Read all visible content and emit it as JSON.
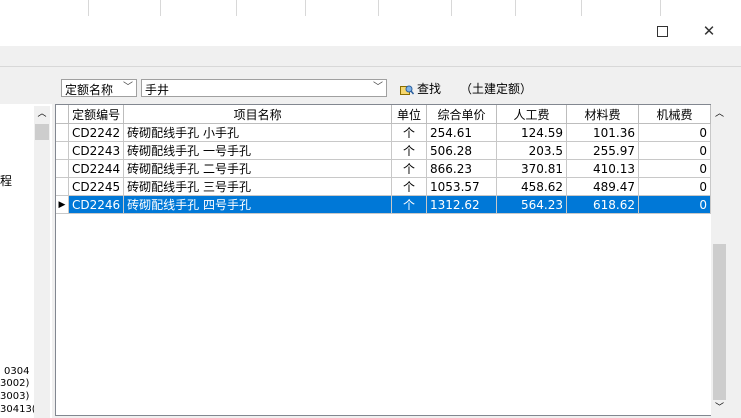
{
  "toolbar": {
    "field_select": "定额名称",
    "search_value": "手井",
    "find_label": "查找",
    "scope_label": "（土建定额）"
  },
  "left_panel": {
    "fragment_top": "程",
    "fragments_bottom": [
      "0304",
      "3002)",
      "3003)",
      "30413("
    ]
  },
  "grid": {
    "columns": [
      "定额编号",
      "项目名称",
      "单位",
      "综合单价",
      "人工费",
      "材料费",
      "机械费"
    ],
    "rows": [
      {
        "code": "CD2242",
        "name": "砖砌配线手孔 小手孔",
        "unit": "个",
        "price": "254.61",
        "labor": "124.59",
        "material": "101.36",
        "machine": "0"
      },
      {
        "code": "CD2243",
        "name": "砖砌配线手孔 一号手孔",
        "unit": "个",
        "price": "506.28",
        "labor": "203.5",
        "material": "255.97",
        "machine": "0"
      },
      {
        "code": "CD2244",
        "name": "砖砌配线手孔 二号手孔",
        "unit": "个",
        "price": "866.23",
        "labor": "370.81",
        "material": "410.13",
        "machine": "0"
      },
      {
        "code": "CD2245",
        "name": "砖砌配线手孔 三号手孔",
        "unit": "个",
        "price": "1053.57",
        "labor": "458.62",
        "material": "489.47",
        "machine": "0"
      },
      {
        "code": "CD2246",
        "name": "砖砌配线手孔 四号手孔",
        "unit": "个",
        "price": "1312.62",
        "labor": "564.23",
        "material": "618.62",
        "machine": "0"
      }
    ],
    "selected_index": 4,
    "row_indicator": "▶"
  },
  "colors": {
    "selection": "#0078d7"
  }
}
